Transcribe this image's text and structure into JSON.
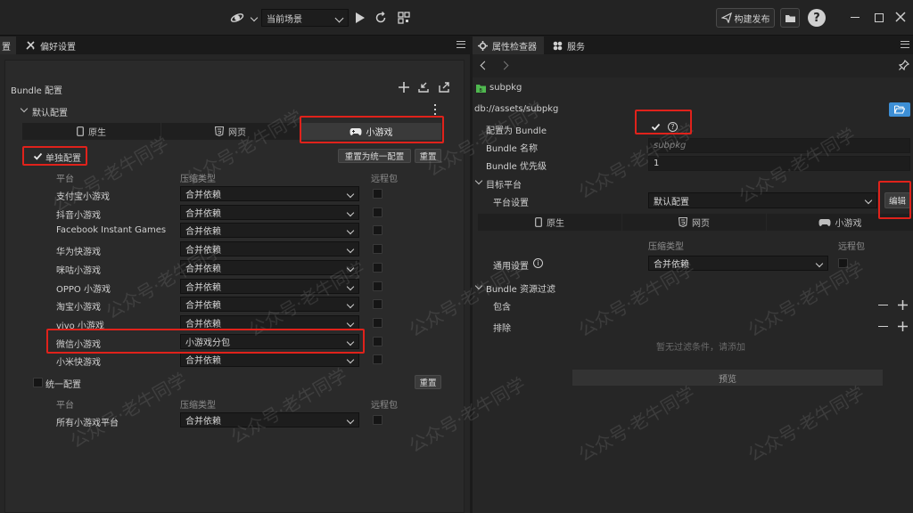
{
  "topbar": {
    "scene_label": "当前场景",
    "build_label": "构建发布",
    "help_glyph": "?"
  },
  "left_panel": {
    "tab_partial": "置",
    "tab_prefs": "偏好设置",
    "title": "Bundle 配置",
    "section_default": "默认配置",
    "platform_tabs": [
      "原生",
      "网页",
      "小游戏"
    ],
    "individual_label": "单独配置",
    "reset_unified_label": "重置为统一配置",
    "reset_label": "重置",
    "headers": {
      "platform": "平台",
      "compression": "压缩类型",
      "remote": "远程包"
    },
    "rows": [
      {
        "platform": "支付宝小游戏",
        "compression": "合并依赖"
      },
      {
        "platform": "抖音小游戏",
        "compression": "合并依赖"
      },
      {
        "platform": "Facebook Instant Games",
        "compression": "合并依赖"
      },
      {
        "platform": "华为快游戏",
        "compression": "合并依赖"
      },
      {
        "platform": "咪咕小游戏",
        "compression": "合并依赖"
      },
      {
        "platform": "OPPO 小游戏",
        "compression": "合并依赖"
      },
      {
        "platform": "淘宝小游戏",
        "compression": "合并依赖"
      },
      {
        "platform": "vivo 小游戏",
        "compression": "合并依赖"
      },
      {
        "platform": "微信小游戏",
        "compression": "小游戏分包"
      },
      {
        "platform": "小米快游戏",
        "compression": "合并依赖"
      }
    ],
    "unified_label": "统一配置",
    "unified_reset_label": "重置",
    "unified_row": {
      "platform": "所有小游戏平台",
      "compression": "合并依赖"
    }
  },
  "right_panel": {
    "tab_inspector": "属性检查器",
    "tab_service": "服务",
    "asset_name": "subpkg",
    "asset_path": "db://assets/subpkg",
    "is_bundle_label": "配置为 Bundle",
    "bundle_name_label": "Bundle 名称",
    "bundle_name_placeholder": "subpkg",
    "priority_label": "Bundle 优先级",
    "priority_value": "1",
    "target_label": "目标平台",
    "platform_settings_label": "平台设置",
    "platform_settings_value": "默认配置",
    "edit_label": "编辑",
    "platform_tabs": [
      "原生",
      "网页",
      "小游戏"
    ],
    "compression_header": "压缩类型",
    "remote_header": "远程包",
    "general_label": "通用设置",
    "general_value": "合并依赖",
    "filter_label": "Bundle 资源过滤",
    "include_label": "包含",
    "exclude_label": "排除",
    "no_filter_hint": "暂无过滤条件，请添加",
    "preview_label": "预览"
  },
  "watermark": "公众号·老牛同学",
  "colors": {
    "highlight": "#e0221b",
    "folder_btn": "#3d8fd6",
    "asset_icon": "#4fb84f"
  }
}
